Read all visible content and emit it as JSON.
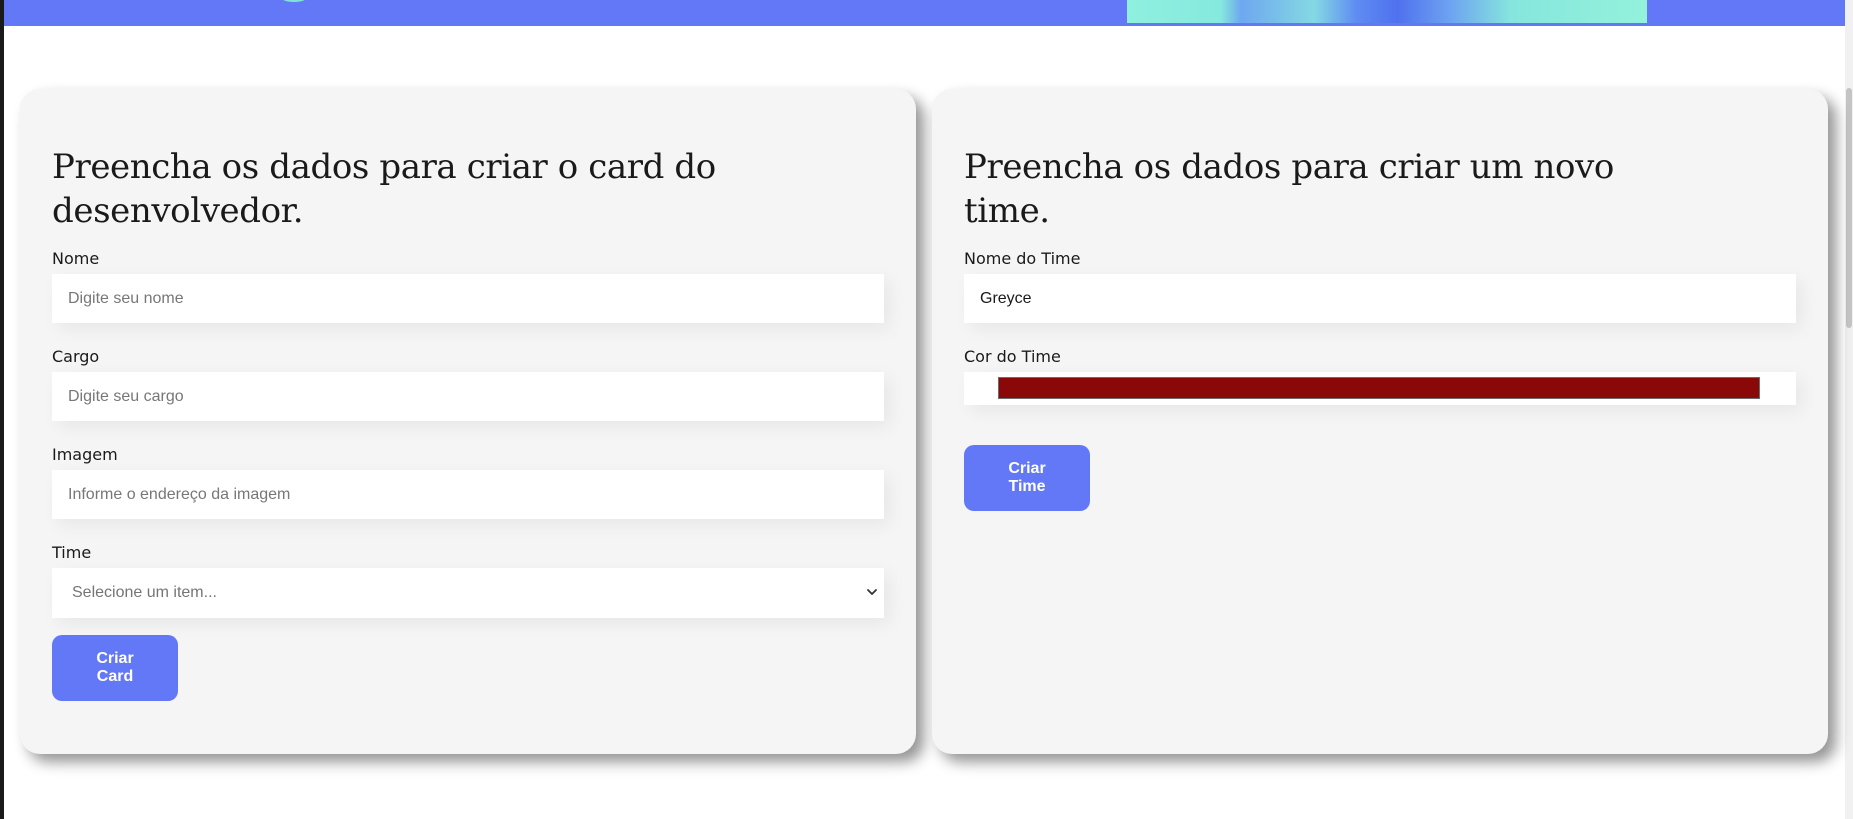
{
  "colors": {
    "accent": "#6278f7",
    "card_background": "#f5f5f5",
    "team_color": "#8b0808"
  },
  "developer_form": {
    "title": "Preencha os dados para criar o card do desenvolvedor.",
    "name": {
      "label": "Nome",
      "placeholder": "Digite seu nome",
      "value": ""
    },
    "role": {
      "label": "Cargo",
      "placeholder": "Digite seu cargo",
      "value": ""
    },
    "image": {
      "label": "Imagem",
      "placeholder": "Informe o endereço da imagem",
      "value": ""
    },
    "team": {
      "label": "Time",
      "selected": "Selecione um item...",
      "icon": "chevron-down-icon"
    },
    "submit_label": "Criar Card"
  },
  "team_form": {
    "title": "Preencha os dados para criar um novo time.",
    "name": {
      "label": "Nome do Time",
      "value": "Greyce"
    },
    "color": {
      "label": "Cor do Time",
      "value": "#8b0808"
    },
    "submit_label": "Criar Time"
  }
}
